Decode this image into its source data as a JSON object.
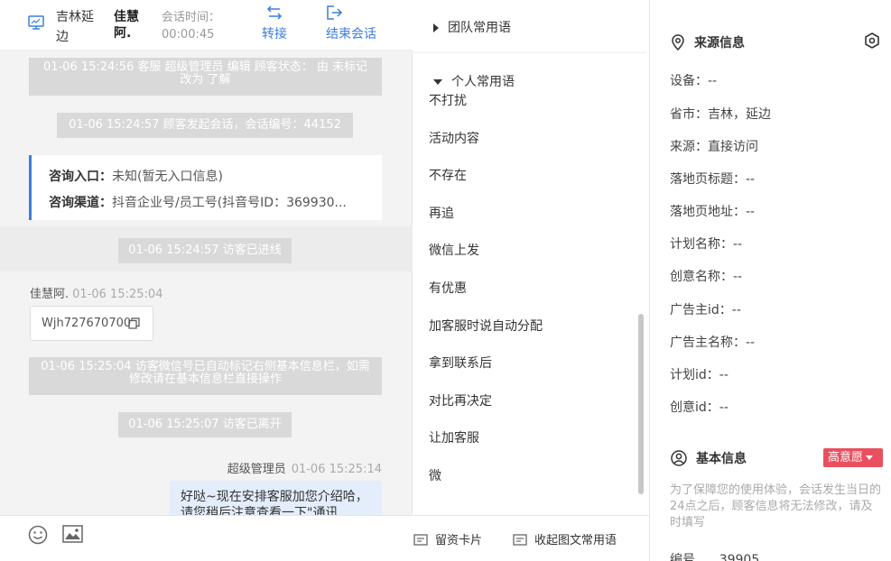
{
  "header": {
    "region": "吉林延边",
    "visitor_name": "佳慧阿.",
    "session_time_label": "会话时间：",
    "session_time_value": "00:00:45",
    "transfer_label": "转接",
    "end_label": "结束会话"
  },
  "messages": {
    "sys1": "01-06 15:24:56 客服 超级管理员 编辑 顾客状态： 由 未标记 改为 了解",
    "sys2": "01-06 15:24:57 顾客发起会话，会话编号：44152",
    "source_card": {
      "entry_key": "咨询入口：",
      "entry_val": "未知(暂无入口信息)",
      "channel_key": "咨询渠道：",
      "channel_val": "抖音企业号/员工号(抖音号ID：369930..."
    },
    "sys3": "01-06 15:24:57 访客已进线",
    "visitor_sender": "佳慧阿.",
    "visitor_time": "01-06 15:25:04",
    "visitor_wechat": "Wjh727670700",
    "sys4": "01-06 15:25:04 访客微信号已自动标记右侧基本信息栏，如需修改请在基本信息栏直接操作",
    "sys5": "01-06 15:25:07 访客已离开",
    "agent_sender": "超级管理员",
    "agent_time": "01-06 15:25:14",
    "agent_text": "好哒~现在安排客服加您介绍哈，请您稍后注意查看一下\"通讯"
  },
  "footer": {
    "emoji_icon": "smile-icon",
    "image_icon": "image-icon"
  },
  "phrases": {
    "team_group": "团队常用语",
    "personal_group": "个人常用语",
    "items": [
      "不打扰",
      "活动内容",
      "不存在",
      "再追",
      "微信上发",
      "有优惠",
      "加客服时说自动分配",
      "拿到联系后",
      "对比再决定",
      "让加客服",
      "微"
    ],
    "card_btn": "留资卡片",
    "collapse_btn": "收起图文常用语"
  },
  "info": {
    "source_title": "来源信息",
    "rows": [
      "设备：--",
      "省市：吉林，延边",
      "来源：直接访问",
      "落地页标题：--",
      "落地页地址：--",
      "计划名称：--",
      "创意名称：--",
      "广告主id：--",
      "广告主名称：--",
      "计划id：--",
      "创意id：--"
    ],
    "basic_title": "基本信息",
    "intent_badge": "高意愿",
    "notice": "为了保障您的使用体验，会话发生当日的24点之后，顾客信息将无法修改，请及时填写",
    "id_row": "编号      39905"
  },
  "colors": {
    "accent": "#3b7ddd",
    "badge": "#e9505f",
    "system_msg_bg": "#d9d9d9",
    "agent_bubble_bg": "#e3edfb"
  }
}
